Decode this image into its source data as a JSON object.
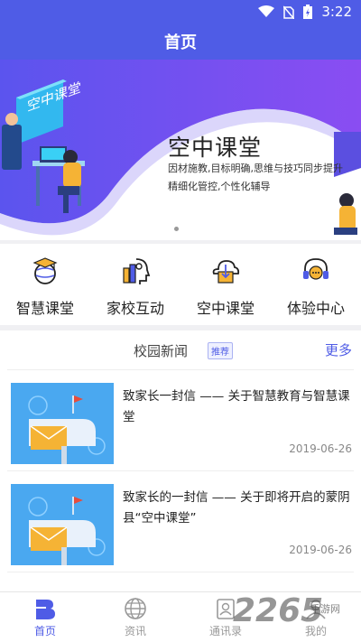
{
  "status_bar": {
    "time": "3:22"
  },
  "header": {
    "title": "首页"
  },
  "banner": {
    "title": "空中课堂",
    "subtitle_line1": "因材施教,目标明确,思维与技巧同步提升",
    "subtitle_line2": "精细化管控,个性化辅导",
    "illustration_text": "空中课堂"
  },
  "quick_nav": [
    {
      "label": "智慧课堂",
      "icon": "graduation-globe-icon"
    },
    {
      "label": "家校互动",
      "icon": "head-books-icon"
    },
    {
      "label": "空中课堂",
      "icon": "cloud-book-icon"
    },
    {
      "label": "体验中心",
      "icon": "headset-chat-icon"
    }
  ],
  "news": {
    "title": "校园新闻",
    "badge": "推荐",
    "more": "更多",
    "items": [
      {
        "title": "致家长一封信 —— 关于智慧教育与智慧课堂",
        "date": "2019-06-26"
      },
      {
        "title": "致家长的一封信 —— 关于即将开启的蒙阴县“空中课堂”",
        "date": "2019-06-26"
      }
    ]
  },
  "tab_bar": [
    {
      "label": "首页",
      "icon": "home-b-icon",
      "active": true
    },
    {
      "label": "资讯",
      "icon": "globe-icon",
      "active": false
    },
    {
      "label": "通讯录",
      "icon": "contacts-icon",
      "active": false
    },
    {
      "label": "我的",
      "icon": "person-icon",
      "active": false
    }
  ],
  "watermark": {
    "text": "2265",
    "sub": "手游网"
  },
  "colors": {
    "primary": "#4f5ce6",
    "banner_purple": "#7b4df0",
    "text": "#222222",
    "muted": "#888888"
  }
}
